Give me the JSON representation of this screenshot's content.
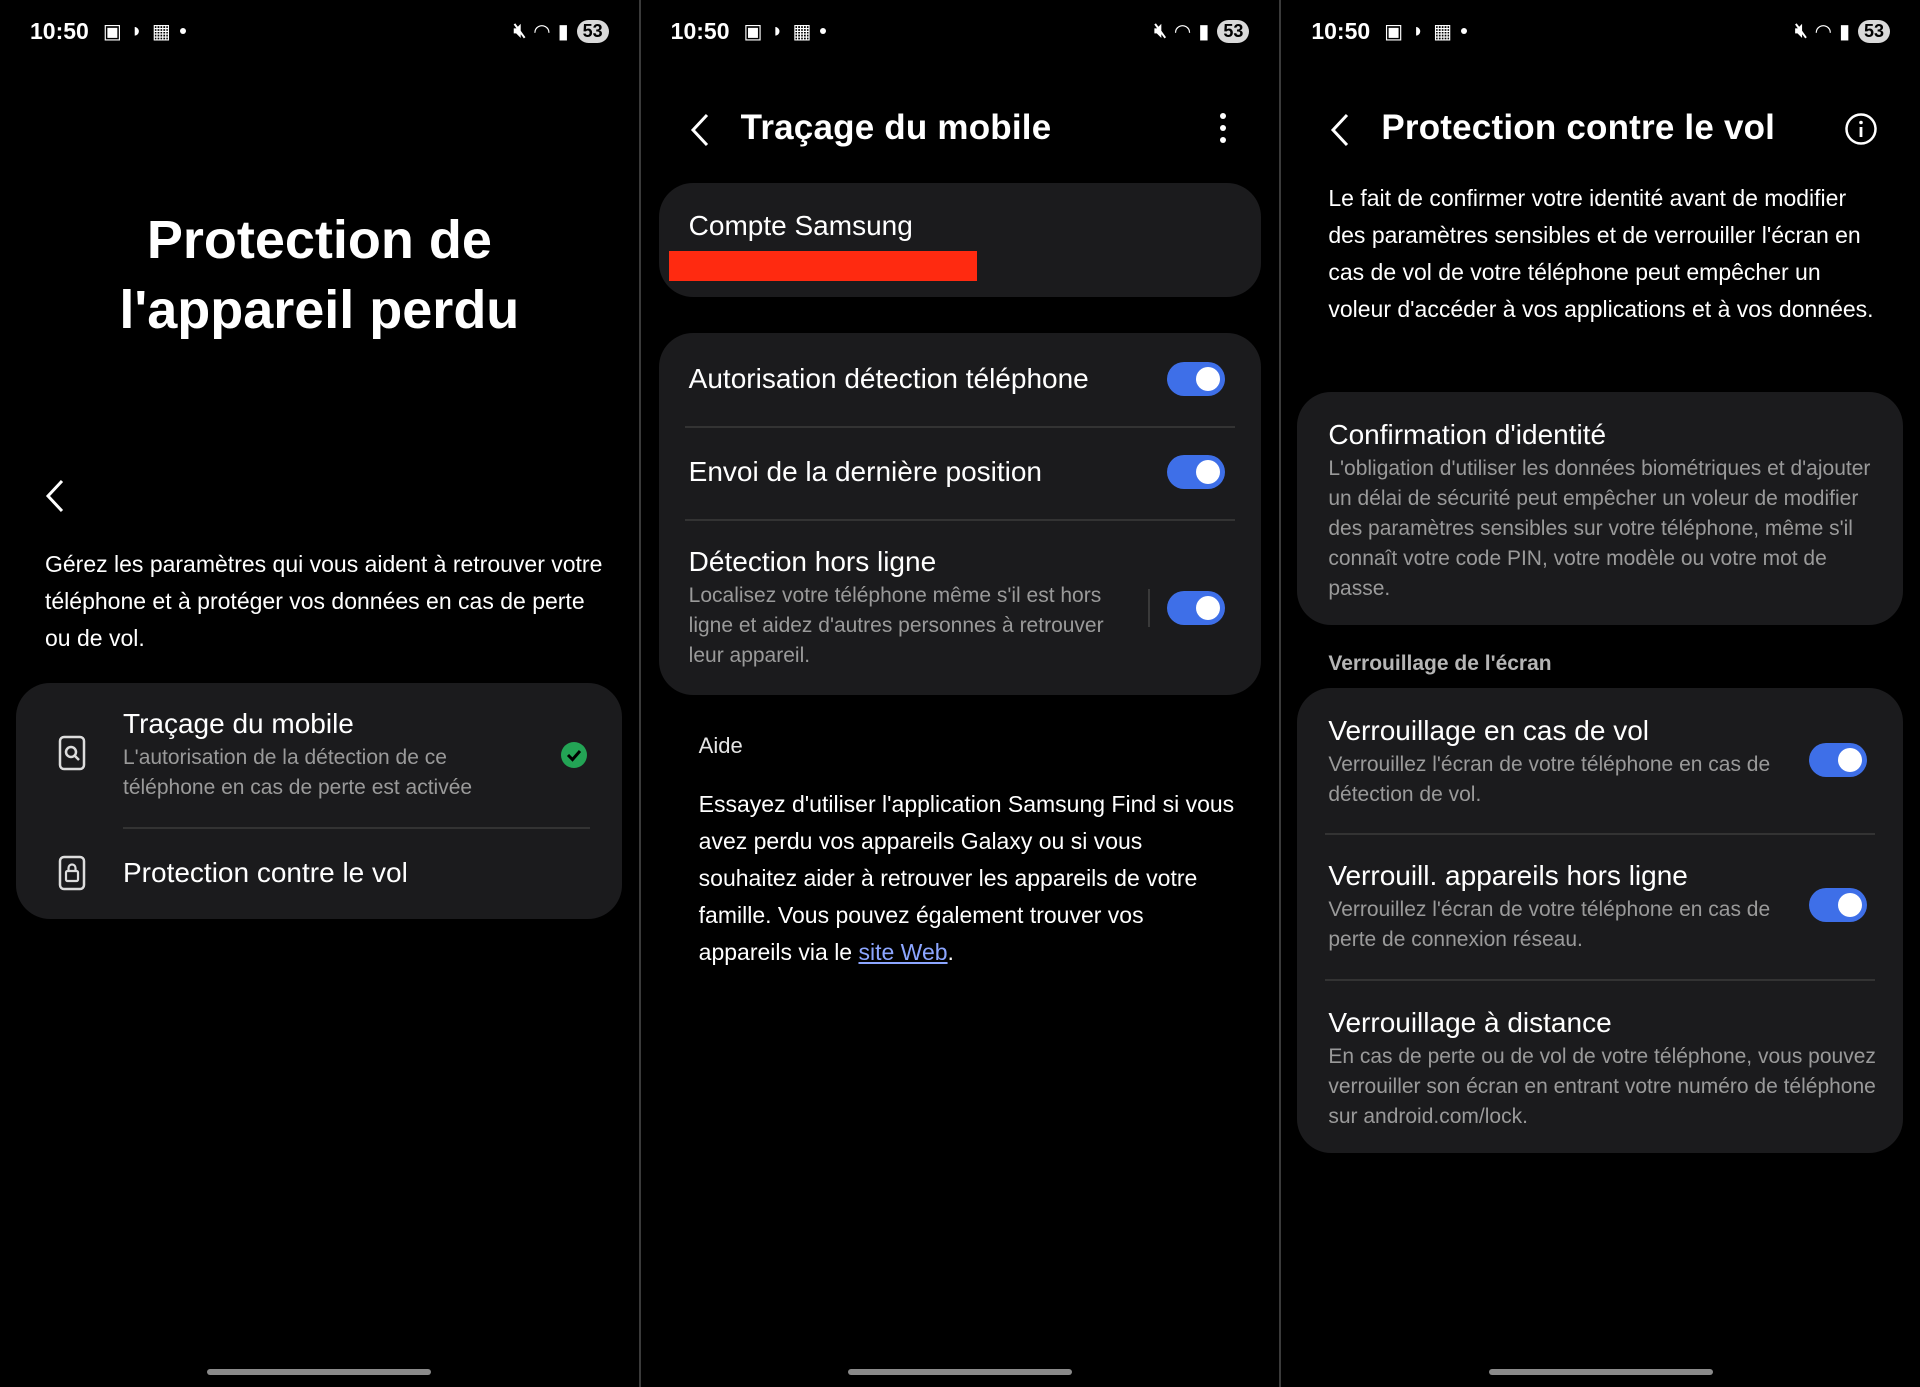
{
  "status": {
    "time": "10:50",
    "battery": "53"
  },
  "screen1": {
    "title_line1": "Protection de",
    "title_line2": "l'appareil perdu",
    "description": "Gérez les paramètres qui vous aident à retrouver votre téléphone et à protéger vos données en cas de perte ou de vol.",
    "items": [
      {
        "title": "Traçage du mobile",
        "subtitle": "L'autorisation de la détection de ce téléphone en cas de perte est activée"
      },
      {
        "title": "Protection contre le vol"
      }
    ]
  },
  "screen2": {
    "title": "Traçage du mobile",
    "account_label": "Compte Samsung",
    "settings": [
      {
        "title": "Autorisation détection téléphone",
        "enabled": true
      },
      {
        "title": "Envoi de la dernière position",
        "enabled": true
      },
      {
        "title": "Détection hors ligne",
        "subtitle": "Localisez votre téléphone même s'il est hors ligne et aidez d'autres personnes à retrouver leur appareil.",
        "enabled": true
      }
    ],
    "help_label": "Aide",
    "help_text": "Essayez d'utiliser l'application Samsung Find si vous avez perdu vos appareils Galaxy ou si vous souhaitez aider à retrouver les appareils de votre famille. Vous pouvez également trouver vos appareils via le",
    "help_link": "site Web",
    "help_end": "."
  },
  "screen3": {
    "title": "Protection contre le vol",
    "intro": "Le fait de confirmer votre identité avant de modifier des paramètres sensibles et de verrouiller l'écran en cas de vol de votre téléphone peut empêcher un voleur d'accéder à vos applications et à vos données.",
    "identity_title": "Confirmation d'identité",
    "identity_sub": "L'obligation d'utiliser les données biométriques et d'ajouter un délai de sécurité peut empêcher un voleur de modifier des paramètres sensibles sur votre téléphone, même s'il connaît votre code PIN, votre modèle ou votre mot de passe.",
    "section_label": "Verrouillage de l'écran",
    "lock_items": [
      {
        "title": "Verrouillage en cas de vol",
        "subtitle": "Verrouillez l'écran de votre téléphone en cas de détection de vol.",
        "enabled": true
      },
      {
        "title": "Verrouill. appareils hors ligne",
        "subtitle": "Verrouillez l'écran de votre téléphone en cas de perte de connexion réseau.",
        "enabled": true
      },
      {
        "title": "Verrouillage à distance",
        "subtitle": "En cas de perte ou de vol de votre téléphone, vous pouvez verrouiller son écran en entrant votre numéro de téléphone sur android.com/lock."
      }
    ]
  },
  "colors": {
    "toggle_on": "#3e6fe8",
    "check_green": "#23a455",
    "redaction": "#ff2a10",
    "card_bg": "#1b1b1d"
  }
}
